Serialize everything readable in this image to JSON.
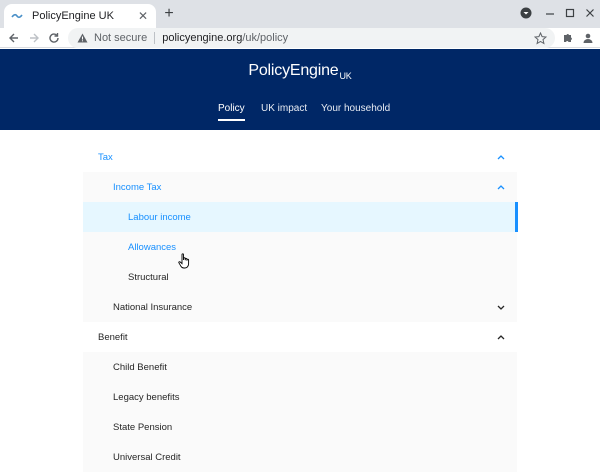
{
  "browser": {
    "tab_title": "PolicyEngine UK",
    "close_glyph": "✕",
    "new_tab_glyph": "+",
    "url_security_label": "Not secure",
    "url_host": "policyengine.org",
    "url_path": "/uk/policy"
  },
  "header": {
    "brand": "PolicyEngine",
    "brand_suffix": "UK",
    "nav": [
      {
        "label": "Policy",
        "active": true
      },
      {
        "label": "UK impact",
        "active": false
      },
      {
        "label": "Your household",
        "active": false
      }
    ]
  },
  "menu": {
    "tax": {
      "label": "Tax",
      "expanded": true
    },
    "income_tax": {
      "label": "Income Tax",
      "expanded": true
    },
    "labour_income": {
      "label": "Labour income",
      "selected": true
    },
    "allowances": {
      "label": "Allowances",
      "hover": true
    },
    "structural": {
      "label": "Structural"
    },
    "national_insurance": {
      "label": "National Insurance",
      "expanded": false
    },
    "benefit": {
      "label": "Benefit",
      "expanded": true
    },
    "child_benefit": {
      "label": "Child Benefit"
    },
    "legacy_benefits": {
      "label": "Legacy benefits"
    },
    "state_pension": {
      "label": "State Pension"
    },
    "universal_credit": {
      "label": "Universal Credit"
    }
  },
  "colors": {
    "header_bg": "#002766",
    "accent": "#1890ff",
    "selected_bg": "#e6f7ff"
  },
  "icons": [
    "favicon-icon",
    "close-icon",
    "plus-icon",
    "profile-icon",
    "minimize-icon",
    "maximize-icon",
    "close-window-icon",
    "back-arrow-icon",
    "forward-arrow-icon",
    "reload-icon",
    "warning-icon",
    "star-icon",
    "puzzle-icon",
    "avatar-icon",
    "chevron-up-icon",
    "chevron-down-icon",
    "hand-cursor-icon"
  ]
}
